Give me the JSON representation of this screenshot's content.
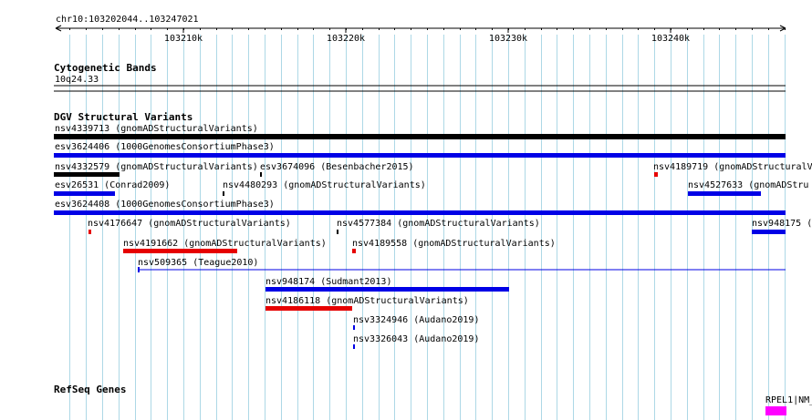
{
  "ruler": {
    "region": "chr10:103202044..103247021",
    "ticks": [
      "103210k",
      "103220k",
      "103230k",
      "103240k"
    ]
  },
  "cytoband_track": {
    "title": "Cytogenetic Bands",
    "band": "10q24.33"
  },
  "dgv_track": {
    "title": "DGV Structural Variants",
    "variants": [
      {
        "label": "nsv4339713 (gnomADStructuralVariants)",
        "color": "#000000"
      },
      {
        "label": "esv3624406 (1000GenomesConsortiumPhase3)",
        "color": "#0000e6"
      },
      {
        "label": "nsv4332579 (gnomADStructuralVariants)",
        "color": "#000000"
      },
      {
        "label": "esv3674096 (Besenbacher2015)",
        "color": "#000000"
      },
      {
        "label": "nsv4189719 (gnomADStructuralV",
        "color": "#e60000"
      },
      {
        "label": "esv26531 (Conrad2009)",
        "color": "#0000e6"
      },
      {
        "label": "nsv4480293 (gnomADStructuralVariants)",
        "color": "#000000"
      },
      {
        "label": "nsv4527633 (gnomADStru",
        "color": "#0000e6"
      },
      {
        "label": "esv3624408 (1000GenomesConsortiumPhase3)",
        "color": "#0000e6"
      },
      {
        "label": "nsv4176647 (gnomADStructuralVariants)",
        "color": "#e60000"
      },
      {
        "label": "nsv4577384 (gnomADStructuralVariants)",
        "color": "#000000"
      },
      {
        "label": "nsv948175 (",
        "color": "#0000e6"
      },
      {
        "label": "nsv4191662 (gnomADStructuralVariants)",
        "color": "#e60000"
      },
      {
        "label": "nsv4189558 (gnomADStructuralVariants)",
        "color": "#e60000"
      },
      {
        "label": "nsv509365 (Teague2010)",
        "color": "#0000e6"
      },
      {
        "label": "nsv948174 (Sudmant2013)",
        "color": "#0000e6"
      },
      {
        "label": "nsv4186118 (gnomADStructuralVariants)",
        "color": "#e60000"
      },
      {
        "label": "nsv3324946 (Audano2019)",
        "color": "#0000e6"
      },
      {
        "label": "nsv3326043 (Audano2019)",
        "color": "#0000e6"
      }
    ]
  },
  "refseq_track": {
    "title": "RefSeq Genes",
    "gene_label": "RPEL1|NM_",
    "gene_color": "#ff00ff"
  },
  "colors": {
    "gridline": "#add8e6",
    "loss": "#e60000",
    "gain": "#0000e6",
    "complex": "#000000"
  }
}
